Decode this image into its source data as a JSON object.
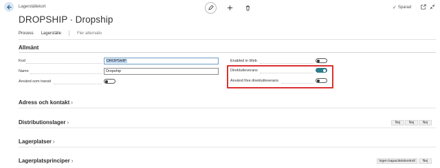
{
  "header": {
    "breadcrumb": "Lagerställekort",
    "title": "DROPSHIP ∙ Dropship",
    "saved_label": "Sparad"
  },
  "actionbar": {
    "items": [
      "Process",
      "Lagerställe",
      "Fler alternativ"
    ]
  },
  "general": {
    "title": "Allmänt",
    "kod_label": "Kod",
    "kod_value": "DROPSHIP",
    "namn_label": "Namn",
    "namn_value": "Dropship",
    "transit_label": "Använd som transit",
    "transit_on": false,
    "web_label": "Enabled in Web",
    "web_on": false,
    "direkt_label": "Direktutleverans",
    "direkt_on": true,
    "fore_direkt_label": "Använd före direktutleverans",
    "fore_direkt_on": false
  },
  "sections": {
    "adress": "Adress och kontakt",
    "distribution": "Distributionslager",
    "distribution_badges": [
      "Nej",
      "Nej",
      "Nej"
    ],
    "lagerplatser": "Lagerplatser",
    "principer": "Lagerplatsprinciper",
    "principer_badges": [
      "Ingen kapacitetskontroll",
      "Nej"
    ]
  },
  "colors": {
    "accent": "#2e7c8c",
    "highlight": "#d93030"
  }
}
